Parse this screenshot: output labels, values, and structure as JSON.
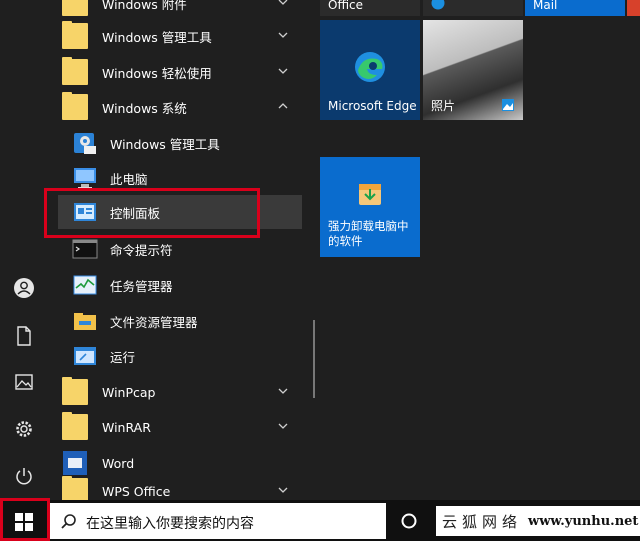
{
  "applist": {
    "items": [
      {
        "label": "Windows 附件",
        "type": "folder",
        "chevron": "down"
      },
      {
        "label": "Windows 管理工具",
        "type": "folder",
        "chevron": "down"
      },
      {
        "label": "Windows 轻松使用",
        "type": "folder",
        "chevron": "down"
      },
      {
        "label": "Windows 系统",
        "type": "folder",
        "chevron": "up"
      },
      {
        "label": "Windows 管理工具",
        "type": "app"
      },
      {
        "label": "此电脑",
        "type": "app"
      },
      {
        "label": "控制面板",
        "type": "app",
        "highlighted": true
      },
      {
        "label": "命令提示符",
        "type": "app"
      },
      {
        "label": "任务管理器",
        "type": "app"
      },
      {
        "label": "文件资源管理器",
        "type": "app"
      },
      {
        "label": "运行",
        "type": "app"
      },
      {
        "label": "WinPcap",
        "type": "folder",
        "chevron": "down"
      },
      {
        "label": "WinRAR",
        "type": "folder",
        "chevron": "down"
      },
      {
        "label": "Word",
        "type": "app"
      },
      {
        "label": "WPS Office",
        "type": "folder",
        "chevron": "down"
      }
    ]
  },
  "rail": {
    "icons": [
      "user-icon",
      "document-icon",
      "pictures-icon",
      "settings-icon",
      "power-icon"
    ]
  },
  "tiles": {
    "office_label": "Office",
    "mail_label": "Mail",
    "edge_label": "Microsoft Edge",
    "photos_label": "照片",
    "uninstaller_label_1": "强力卸载电脑中",
    "uninstaller_label_2": "的软件"
  },
  "taskbar": {
    "search_placeholder": "在这里输入你要搜索的内容"
  },
  "watermark": {
    "brand": "云狐网络",
    "url": "www.yunhu.net"
  },
  "colors": {
    "accent": "#0a6cce",
    "highlight_border": "#d9001b",
    "background": "#1f1f1f"
  }
}
